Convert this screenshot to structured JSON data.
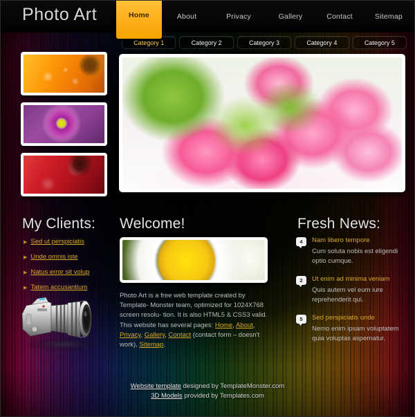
{
  "site": {
    "logo": "Photo Art"
  },
  "nav": {
    "items": [
      {
        "label": "Home",
        "active": true
      },
      {
        "label": "About",
        "active": false
      },
      {
        "label": "Privacy",
        "active": false
      },
      {
        "label": "Gallery",
        "active": false
      },
      {
        "label": "Contact",
        "active": false
      },
      {
        "label": "Sitemap",
        "active": false
      }
    ]
  },
  "categories": [
    {
      "label": "Category 1",
      "active": true
    },
    {
      "label": "Category 2",
      "active": false
    },
    {
      "label": "Category 3",
      "active": false
    },
    {
      "label": "Category 4",
      "active": false
    },
    {
      "label": "Category 5",
      "active": false
    }
  ],
  "thumbnails": [
    {
      "name": "orange-gerbera-waterdrops-thumbnail"
    },
    {
      "name": "purple-daisy-thumbnail"
    },
    {
      "name": "red-flower-waterdrops-thumbnail"
    }
  ],
  "hero": {
    "name": "pink-fringed-tulips-photo"
  },
  "camera": {
    "name": "silver-dslr-camera-render"
  },
  "clients": {
    "heading": "My Clients:",
    "items": [
      {
        "label": "Sed ut perspiciatis"
      },
      {
        "label": "Unde omnis iste"
      },
      {
        "label": "Natus error sit volup"
      },
      {
        "label": "Tatem accusantium"
      }
    ]
  },
  "welcome": {
    "heading": "Welcome!",
    "image": {
      "name": "white-daisy-photo"
    },
    "para_1": "Photo Art is a free web template created by Template-",
    "para_2": "Monster team, optimized for 1024X768 screen resolu-",
    "para_3": "tion. It is also HTML5 & CSS3 valid. This website has",
    "para_4": "several pages: ",
    "links": [
      "Home",
      "About",
      "Privacy",
      "Gallery",
      "Contact"
    ],
    "para_5": "(contact form – doesn't work), ",
    "link_sitemap": "Sitemap",
    "para_end": "."
  },
  "news": {
    "heading": "Fresh News:",
    "items": [
      {
        "badge": "4",
        "title": "Nam libero tempore",
        "desc": "Cum soluta nobis est eligendi optio cumque."
      },
      {
        "badge": "2",
        "title": "Ut enim ad minima veniam",
        "desc": "Quis autem vel eum iure reprehenderit qui."
      },
      {
        "badge": "5",
        "title": "Sed perspiciatis unde",
        "desc": "Nemo enim ipsam voluptatem quia voluptas aspernatur."
      }
    ]
  },
  "footer": {
    "line1_link": "Website template",
    "line1_text": " designed by TemplateMonster.com",
    "line2_link": "3D Models",
    "line2_text": " provided by Templates.com"
  },
  "colors": {
    "accent_gold": "#d9a825",
    "active_tab": "#ffb01e",
    "text_light": "#bdbdbd",
    "heading": "#e4e4e4"
  }
}
